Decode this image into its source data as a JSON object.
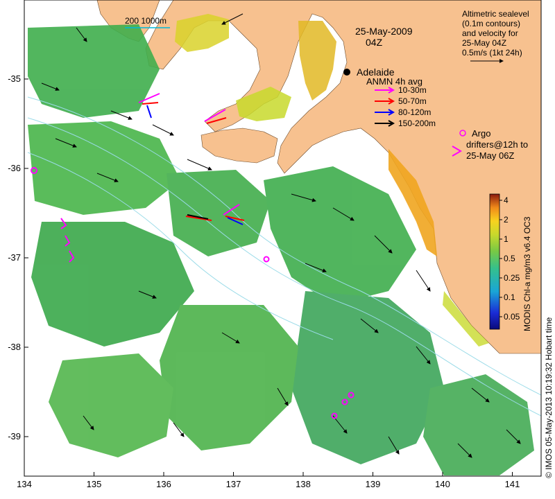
{
  "date": {
    "line1": "25-May-2009",
    "line2": "04Z"
  },
  "city": "Adelaide",
  "scale_bar": "200  1000m",
  "altimetric": {
    "lines": [
      "Altimetric sealevel",
      "(0.1m contours)",
      "and velocity for",
      "25-May 04Z",
      "0.5m/s (1kt 24h)"
    ]
  },
  "anmn": {
    "title": "ANMN 4h avg",
    "items": [
      {
        "label": "10-30m",
        "color": "#ff00ff"
      },
      {
        "label": "50-70m",
        "color": "#ff0000"
      },
      {
        "label": "80-120m",
        "color": "#0000ff"
      },
      {
        "label": "150-200m",
        "color": "#000000"
      }
    ]
  },
  "argo": {
    "line1": "Argo",
    "line2": "drifters@12h to",
    "line3": "25-May 06Z",
    "color": "#ff00ff"
  },
  "colorbar": {
    "title": "MODIS Chl-a mg/m3 v6.4 OC3",
    "ticks": [
      "4",
      "2",
      "1",
      "0.5",
      "0.25",
      "0.1",
      "0.05"
    ]
  },
  "x_ticks": [
    "134",
    "135",
    "136",
    "137",
    "138",
    "139",
    "140",
    "141"
  ],
  "y_ticks": [
    "-35",
    "-36",
    "-37",
    "-38",
    "-39"
  ],
  "credit": "© IMOS 05-May-2013 10:19:32 Hobart time",
  "colors": {
    "land": "#f7c18f",
    "ocean": "#ffffff",
    "chl_green": "#4caf50",
    "argo": "#ff00ff"
  }
}
